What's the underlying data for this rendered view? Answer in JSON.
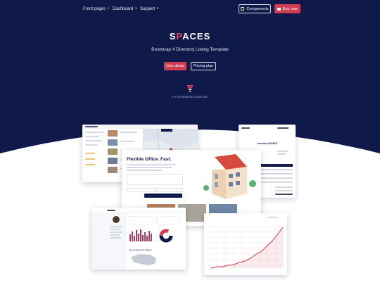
{
  "nav": {
    "items": [
      {
        "label": "Front pages"
      },
      {
        "label": "Dashboard"
      },
      {
        "label": "Support"
      }
    ],
    "components_label": "Components",
    "buy_label": "Buy now"
  },
  "hero": {
    "logo_left": "S",
    "logo_p": "P",
    "logo_right": "ACES",
    "subtitle": "Bootstrap 4 Directory Listing Template",
    "demo_label": "Live demo",
    "pricing_label": "Pricing plan",
    "production": "A Themesberg production"
  },
  "previews": {
    "listing_title": "Flexible Office. Fast.",
    "invoice_title": "Invoice #32345",
    "card1_title": "Meeting Space",
    "card2_title": "Meeting Office Space",
    "dashboard_map_title": "Reservations by Market"
  },
  "colors": {
    "navy": "#0f1a4a",
    "accent": "#cf3d52"
  }
}
